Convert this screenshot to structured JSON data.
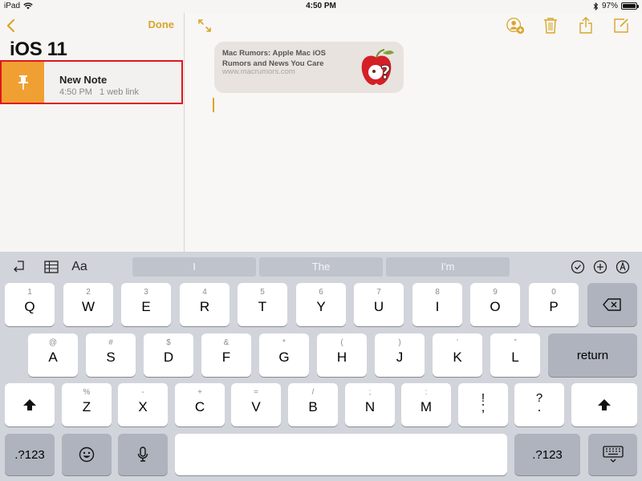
{
  "status_bar": {
    "device": "iPad",
    "time": "4:50 PM",
    "battery": "97%",
    "battery_level": 0.97
  },
  "sidebar": {
    "done_label": "Done",
    "folder_title": "iOS 11",
    "note": {
      "title": "New Note",
      "time": "4:50 PM",
      "meta": "1 web link"
    }
  },
  "main": {
    "link_card": {
      "title": "Mac Rumors: Apple Mac iOS Rumors and News You Care",
      "url": "www.macrumors.com"
    }
  },
  "keyboard": {
    "suggestions": [
      "I",
      "The",
      "I'm"
    ],
    "format_label": "Aa",
    "row1": [
      {
        "main": "Q",
        "alt": "1"
      },
      {
        "main": "W",
        "alt": "2"
      },
      {
        "main": "E",
        "alt": "3"
      },
      {
        "main": "R",
        "alt": "4"
      },
      {
        "main": "T",
        "alt": "5"
      },
      {
        "main": "Y",
        "alt": "6"
      },
      {
        "main": "U",
        "alt": "7"
      },
      {
        "main": "I",
        "alt": "8"
      },
      {
        "main": "O",
        "alt": "9"
      },
      {
        "main": "P",
        "alt": "0"
      }
    ],
    "row2": [
      {
        "main": "A",
        "alt": "@"
      },
      {
        "main": "S",
        "alt": "#"
      },
      {
        "main": "D",
        "alt": "$"
      },
      {
        "main": "F",
        "alt": "&"
      },
      {
        "main": "G",
        "alt": "*"
      },
      {
        "main": "H",
        "alt": "("
      },
      {
        "main": "J",
        "alt": ")"
      },
      {
        "main": "K",
        "alt": "’"
      },
      {
        "main": "L",
        "alt": "”"
      }
    ],
    "row3": [
      {
        "main": "Z",
        "alt": "%"
      },
      {
        "main": "X",
        "alt": "-"
      },
      {
        "main": "C",
        "alt": "+"
      },
      {
        "main": "V",
        "alt": "="
      },
      {
        "main": "B",
        "alt": "/"
      },
      {
        "main": "N",
        "alt": ";"
      },
      {
        "main": "M",
        "alt": ":"
      },
      {
        "main": ";",
        "alt": "!"
      },
      {
        "main": ".",
        "alt": "?"
      }
    ],
    "return_label": "return",
    "numbers_label": ".?123",
    "numbers_label_right": ".?123"
  }
}
